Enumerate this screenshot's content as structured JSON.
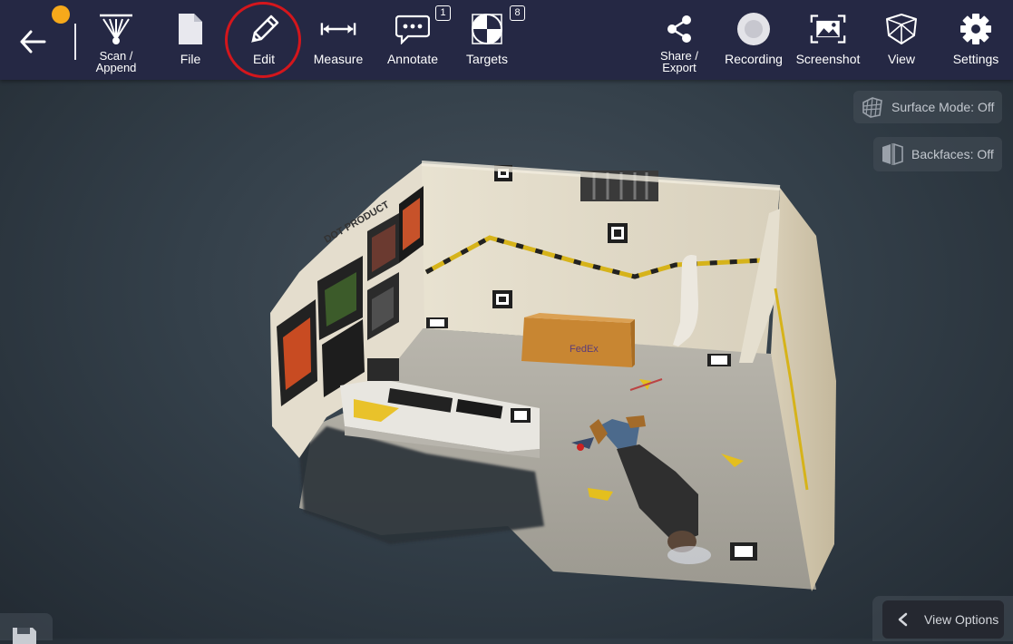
{
  "toolbar": {
    "items": [
      {
        "label": "Scan /\nAppend",
        "icon": "scan-append-icon"
      },
      {
        "label": "File",
        "icon": "file-icon"
      },
      {
        "label": "Edit",
        "icon": "pencil-icon"
      },
      {
        "label": "Measure",
        "icon": "measure-icon"
      },
      {
        "label": "Annotate",
        "icon": "annotate-icon",
        "badge": "1"
      },
      {
        "label": "Targets",
        "icon": "targets-icon",
        "badge": "8"
      },
      {
        "label": "Share /\nExport",
        "icon": "share-icon"
      },
      {
        "label": "Recording",
        "icon": "record-icon"
      },
      {
        "label": "Screenshot",
        "icon": "screenshot-icon"
      },
      {
        "label": "View",
        "icon": "view-cube-icon"
      },
      {
        "label": "Settings",
        "icon": "gear-icon"
      }
    ],
    "status_dot_color": "#f6a91b",
    "highlight_color": "#d4161c"
  },
  "overlay": {
    "surface_mode": "Surface Mode: Off",
    "backfaces": "Backfaces: Off",
    "view_options": "View Options"
  },
  "scene": {
    "box_label": "FedEx",
    "poster_text": "DOT PRODUCT"
  }
}
